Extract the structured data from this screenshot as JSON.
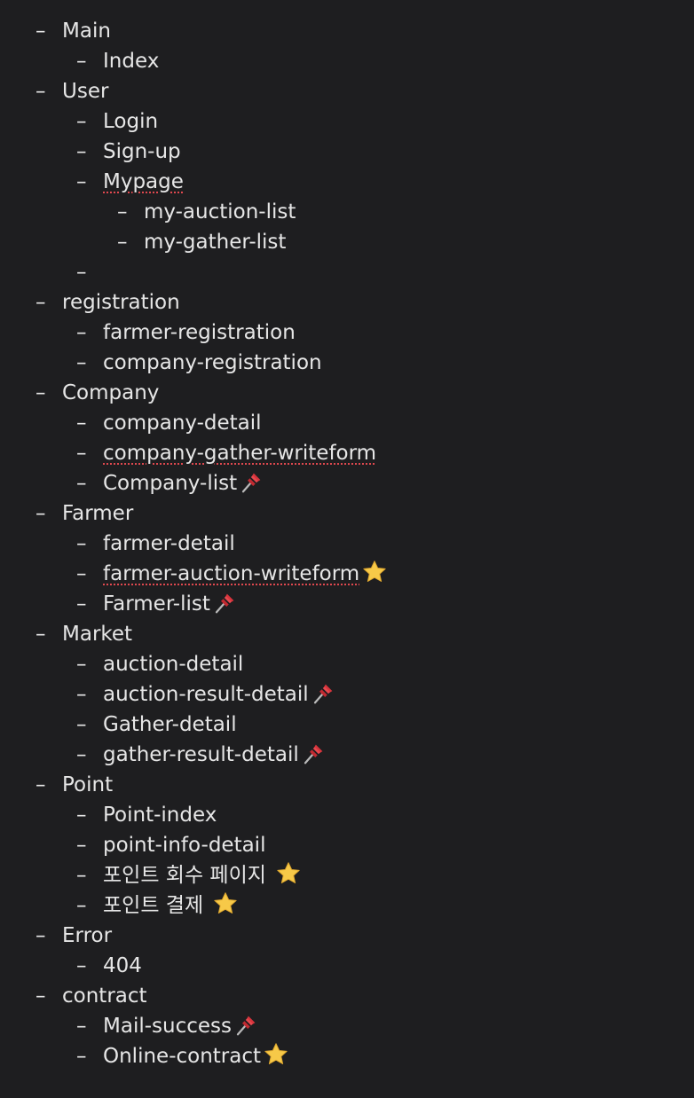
{
  "outline": [
    {
      "level": 0,
      "text": "Main"
    },
    {
      "level": 1,
      "text": "Index"
    },
    {
      "level": 0,
      "text": "User"
    },
    {
      "level": 1,
      "text": "Login"
    },
    {
      "level": 1,
      "text": "Sign-up"
    },
    {
      "level": 1,
      "text": "Mypage",
      "spellcheck": true
    },
    {
      "level": 2,
      "text": "my-auction-list"
    },
    {
      "level": 2,
      "text": "my-gather-list"
    },
    {
      "level": 1,
      "text": ""
    },
    {
      "level": 0,
      "text": "registration"
    },
    {
      "level": 1,
      "text": "farmer-registration"
    },
    {
      "level": 1,
      "text": "company-registration"
    },
    {
      "level": 0,
      "text": "Company"
    },
    {
      "level": 1,
      "text": "company-detail"
    },
    {
      "level": 1,
      "text": "company-gather-writeform",
      "spellcheck": true
    },
    {
      "level": 1,
      "text": "Company-list",
      "icon": "pushpin-icon"
    },
    {
      "level": 0,
      "text": "Farmer"
    },
    {
      "level": 1,
      "text": "farmer-detail"
    },
    {
      "level": 1,
      "text": "farmer-auction-writeform",
      "spellcheck": true,
      "icon": "star-icon"
    },
    {
      "level": 1,
      "text": "Farmer-list",
      "icon": "pushpin-icon"
    },
    {
      "level": 0,
      "text": "Market"
    },
    {
      "level": 1,
      "text": "auction-detail"
    },
    {
      "level": 1,
      "text": "auction-result-detail",
      "icon": "pushpin-icon"
    },
    {
      "level": 1,
      "text": "Gather-detail"
    },
    {
      "level": 1,
      "text": "gather-result-detail",
      "icon": "pushpin-icon"
    },
    {
      "level": 0,
      "text": "Point"
    },
    {
      "level": 1,
      "text": "Point-index"
    },
    {
      "level": 1,
      "text": "point-info-detail"
    },
    {
      "level": 1,
      "text": "포인트 회수 페이지",
      "icon": "star-icon",
      "icon_gap": true
    },
    {
      "level": 1,
      "text": "포인트 결제",
      "icon": "star-icon",
      "icon_gap": true
    },
    {
      "level": 0,
      "text": "Error"
    },
    {
      "level": 1,
      "text": "404"
    },
    {
      "level": 0,
      "text": "contract"
    },
    {
      "level": 1,
      "text": "Mail-success",
      "icon": "pushpin-icon"
    },
    {
      "level": 1,
      "text": "Online-contract",
      "icon": "star-icon"
    }
  ],
  "colors": {
    "background": "#1e1e20",
    "text": "#e6e6e6",
    "spellcheck_underline": "#e0484f",
    "star": "#f7c948",
    "pin": "#d8343c"
  }
}
